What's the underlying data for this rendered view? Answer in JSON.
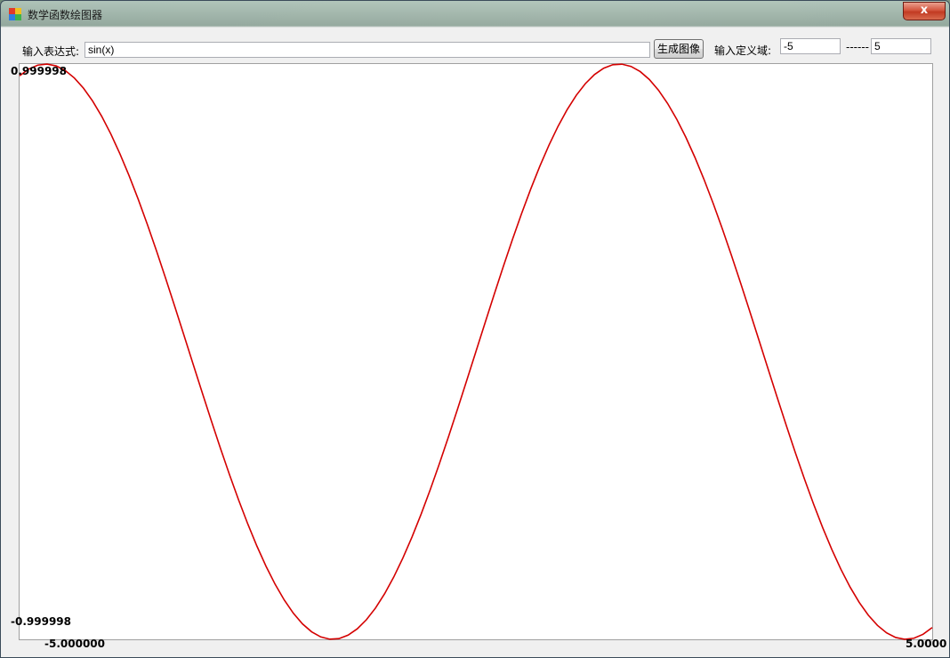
{
  "window": {
    "title": "数学函数绘图器",
    "close_label": "x"
  },
  "toolbar": {
    "expr_label": "输入表达式:",
    "expr_value": "sin(x)",
    "generate_label": "生成图像",
    "domain_label": "输入定义域:",
    "domain_min": "-5",
    "separator": "------",
    "domain_max": "5"
  },
  "chart_data": {
    "type": "line",
    "function": "sin(x)",
    "xlim": [
      -5,
      5
    ],
    "ylim": [
      -0.999998,
      0.999998
    ],
    "y_max_label": "0.999998",
    "y_min_label": "-0.999998",
    "x_min_label": "-5.000000",
    "x_max_label": "5.0000",
    "line_color": "#d40000",
    "series": [
      {
        "x": [
          -5.0,
          -4.9,
          -4.8,
          -4.7,
          -4.6,
          -4.5,
          -4.4,
          -4.3,
          -4.2,
          -4.1,
          -4.0,
          -3.9,
          -3.8,
          -3.7,
          -3.6,
          -3.5,
          -3.4,
          -3.3,
          -3.2,
          -3.1,
          -3.0,
          -2.9,
          -2.8,
          -2.7,
          -2.6,
          -2.5,
          -2.4,
          -2.3,
          -2.2,
          -2.1,
          -2.0,
          -1.9,
          -1.8,
          -1.7,
          -1.6,
          -1.5,
          -1.4,
          -1.3,
          -1.2,
          -1.1,
          -1.0,
          -0.9,
          -0.8,
          -0.7,
          -0.6,
          -0.5,
          -0.4,
          -0.3,
          -0.2,
          -0.1,
          0.0,
          0.1,
          0.2,
          0.3,
          0.4,
          0.5,
          0.6,
          0.7,
          0.8,
          0.9,
          1.0,
          1.1,
          1.2,
          1.3,
          1.4,
          1.5,
          1.6,
          1.7,
          1.8,
          1.9,
          2.0,
          2.1,
          2.2,
          2.3,
          2.4,
          2.5,
          2.6,
          2.7,
          2.8,
          2.9,
          3.0,
          3.1,
          3.2,
          3.3,
          3.4,
          3.5,
          3.6,
          3.7,
          3.8,
          3.9,
          4.0,
          4.1,
          4.2,
          4.3,
          4.4,
          4.5,
          4.6,
          4.7,
          4.8,
          4.9,
          5.0
        ],
        "y": [
          0.95892,
          0.98245,
          0.99616,
          0.99992,
          0.99369,
          0.97753,
          0.9516,
          0.91617,
          0.87158,
          0.81828,
          0.7568,
          0.68777,
          0.61186,
          0.52984,
          0.44252,
          0.35078,
          0.25554,
          0.15775,
          0.05837,
          -0.04158,
          -0.14112,
          -0.23925,
          -0.33499,
          -0.42738,
          -0.5155,
          -0.59847,
          -0.67546,
          -0.74571,
          -0.8085,
          -0.86321,
          -0.9093,
          -0.9463,
          -0.97385,
          -0.99166,
          -0.99957,
          -0.99749,
          -0.98545,
          -0.96356,
          -0.93204,
          -0.89121,
          -0.84147,
          -0.78333,
          -0.71736,
          -0.64422,
          -0.56464,
          -0.47943,
          -0.38942,
          -0.29552,
          -0.19867,
          -0.09983,
          0.0,
          0.09983,
          0.19867,
          0.29552,
          0.38942,
          0.47943,
          0.56464,
          0.64422,
          0.71736,
          0.78333,
          0.84147,
          0.89121,
          0.93204,
          0.96356,
          0.98545,
          0.99749,
          0.99957,
          0.99166,
          0.97385,
          0.9463,
          0.9093,
          0.86321,
          0.8085,
          0.74571,
          0.67546,
          0.59847,
          0.5155,
          0.42738,
          0.33499,
          0.23925,
          0.14112,
          0.04158,
          -0.05837,
          -0.15775,
          -0.25554,
          -0.35078,
          -0.44252,
          -0.52984,
          -0.61186,
          -0.68777,
          -0.7568,
          -0.81828,
          -0.87158,
          -0.91617,
          -0.9516,
          -0.97753,
          -0.99369,
          -0.99992,
          -0.99616,
          -0.98245,
          -0.95892
        ]
      }
    ]
  }
}
